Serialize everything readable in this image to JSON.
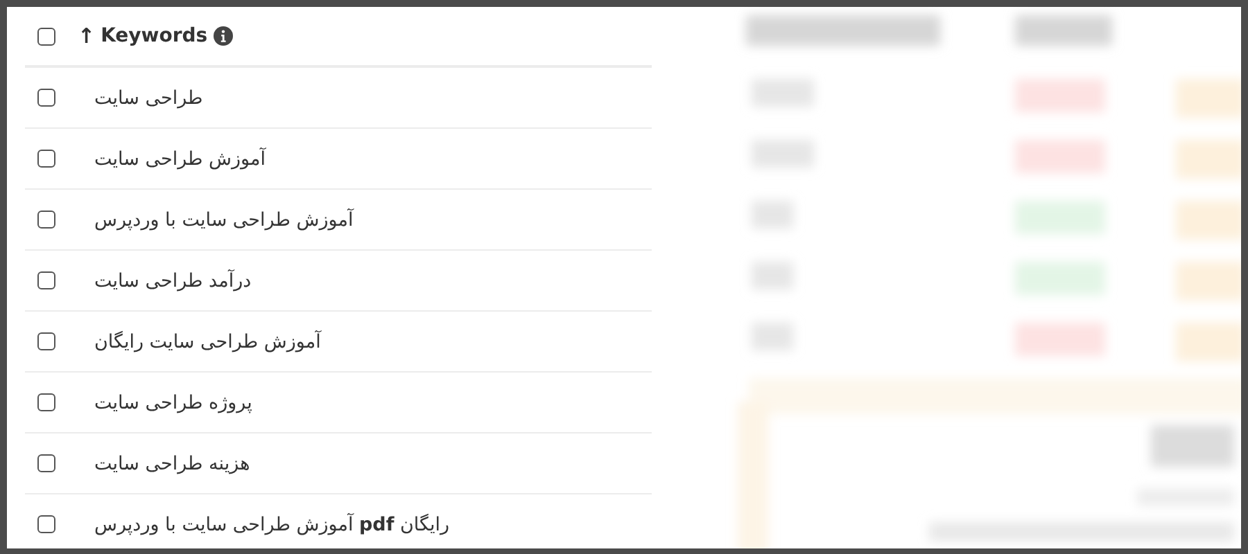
{
  "table": {
    "header": {
      "checked": false,
      "sort_arrow": "↑",
      "label": "Keywords"
    },
    "rows": [
      {
        "checked": false,
        "keyword": "طراحی سایت"
      },
      {
        "checked": false,
        "keyword": "آموزش طراحی سایت"
      },
      {
        "checked": false,
        "keyword": "آموزش طراحی سایت با وردپرس"
      },
      {
        "checked": false,
        "keyword": "درآمد طراحی سایت"
      },
      {
        "checked": false,
        "keyword": "آموزش طراحی سایت رایگان"
      },
      {
        "checked": false,
        "keyword": "پروژه طراحی سایت"
      },
      {
        "checked": false,
        "keyword": "هزینه طراحی سایت"
      },
      {
        "checked": false,
        "keyword": "رایگان **pdf** آموزش طراحی سایت با وردپرس"
      }
    ]
  }
}
